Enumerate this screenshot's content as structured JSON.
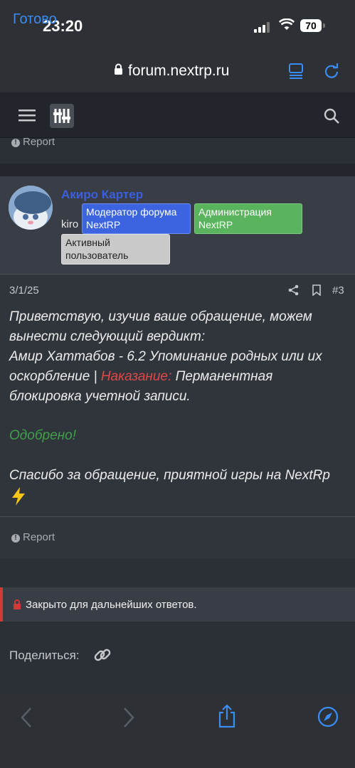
{
  "status_bar": {
    "time": "23:20",
    "battery": "70"
  },
  "browser": {
    "done_label": "Готово",
    "url": "forum.nextrp.ru"
  },
  "post_top": {
    "report_label": "Report"
  },
  "post": {
    "author": "Акиро Картер",
    "user_title": "kiro",
    "badges": [
      "Модератор форума NextRP",
      "Администрация NextRP",
      "Активный пользователь"
    ],
    "date": "3/1/25",
    "number": "#3",
    "greeting": "Приветствую, изучив ваше обращение, можем вынести следующий вердикт:",
    "verdict_prefix": "Амир Хаттабов - 6.2 Упоминание родных или их оскорбление |",
    "punishment_label": "Наказание:",
    "punishment_value": "Перманентная блокировка учетной записи.",
    "approved": "Одобрено!",
    "thanks": "Спасибо за обращение, приятной игры на NextRp",
    "report_label": "Report"
  },
  "thread_status": {
    "closed_text": "Закрыто для дальнейших ответов."
  },
  "share": {
    "label": "Поделиться:"
  },
  "colors": {
    "accent": "#3b8df5",
    "username": "#3b5fe0",
    "moderator_badge": "#3d64e0",
    "admin_badge": "#5ab45e",
    "punishment": "#e04848",
    "approved": "#3fa24a"
  }
}
